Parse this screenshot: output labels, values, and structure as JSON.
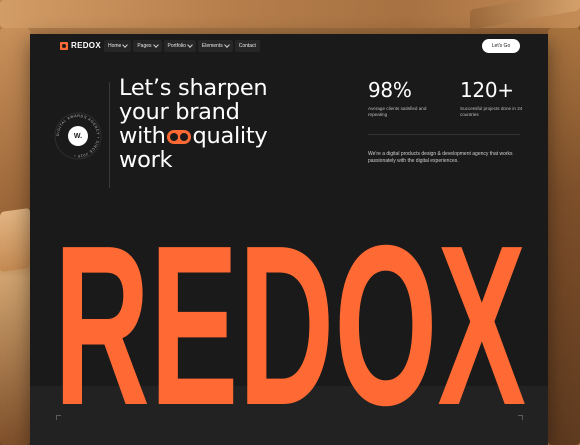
{
  "nav": {
    "logo_text": "REDOX",
    "items": [
      {
        "label": "Home",
        "has_dropdown": true
      },
      {
        "label": "Pages",
        "has_dropdown": true
      },
      {
        "label": "Portfolio",
        "has_dropdown": true
      },
      {
        "label": "Elements",
        "has_dropdown": true
      },
      {
        "label": "Contact",
        "has_dropdown": false
      }
    ],
    "cta_label": "Let's Go"
  },
  "badge": {
    "ring_text": "DIGITAL AWARDS AGENCY • SINCE 2020 •",
    "center_text": "W."
  },
  "hero": {
    "line1": "Let’s sharpen",
    "line2": "your brand",
    "line3_before": "with",
    "line3_after": "quality",
    "line4": "work"
  },
  "stats": [
    {
      "value": "98%",
      "label": "Average clients satisfied and repeating"
    },
    {
      "value": "120+",
      "label": "Successful projects done in 24 countries"
    }
  ],
  "description": "We're a digital products design & development agency that works passionately with the digital experiences.",
  "wordmark": "REDOX",
  "colors": {
    "accent": "#ff6a34",
    "background": "#1a1a1a",
    "text": "#ffffff"
  }
}
